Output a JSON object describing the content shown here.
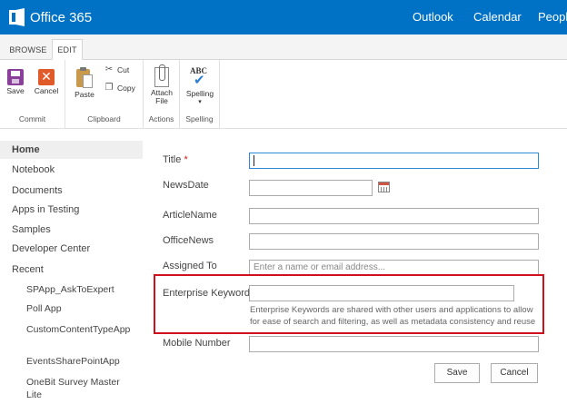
{
  "suite": {
    "brand": "Office 365",
    "nav": [
      "Outlook",
      "Calendar",
      "People"
    ]
  },
  "ribbon": {
    "tabs": [
      "BROWSE",
      "EDIT"
    ],
    "groups": {
      "commit": {
        "label": "Commit",
        "save": "Save",
        "cancel": "Cancel"
      },
      "clipboard": {
        "label": "Clipboard",
        "paste": "Paste",
        "cut": "Cut",
        "copy": "Copy"
      },
      "actions": {
        "label": "Actions",
        "attach_line1": "Attach",
        "attach_line2": "File"
      },
      "spelling": {
        "label": "Spelling",
        "spelling": "Spelling",
        "icon_text": "ABC"
      }
    }
  },
  "leftnav": {
    "items": [
      "Home",
      "Notebook",
      "Documents",
      "Apps in Testing",
      "Samples",
      "Developer Center",
      "Recent"
    ],
    "recent": [
      "SPApp_AskToExpert",
      "Poll App",
      "CustomContentTypeApp",
      "EventsSharePointApp",
      "OneBit Survey Master Lite"
    ]
  },
  "form": {
    "title_label": "Title",
    "required_mark": "*",
    "newsdate_label": "NewsDate",
    "articlename_label": "ArticleName",
    "officenews_label": "OfficeNews",
    "assignedto_label": "Assigned To",
    "assignedto_placeholder": "Enter a name or email address...",
    "keywords_label": "Enterprise Keywords",
    "keywords_hint": "Enterprise Keywords are shared with other users and applications to allow for ease of search and filtering, as well as metadata consistency and reuse",
    "mobile_label": "Mobile Number",
    "save_button": "Save",
    "cancel_button": "Cancel"
  },
  "colors": {
    "suite_bar": "#0072c6",
    "highlight_border": "#d0101b",
    "required": "#c52222"
  }
}
